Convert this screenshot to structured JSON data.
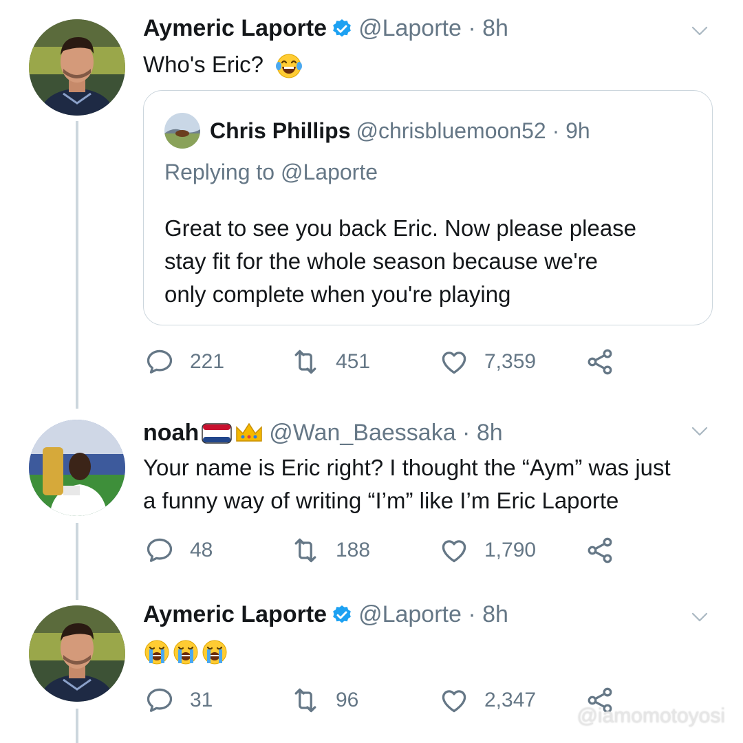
{
  "tweets": [
    {
      "name": "Aymeric Laporte",
      "handle": "@Laporte · 8h",
      "text_lines": [
        "Who's Eric?"
      ],
      "emoji": [
        "face-with-tears-of-joy"
      ],
      "quote": {
        "name": "Chris Phillips",
        "handle": "@chrisbluemoon52 · 9h",
        "replying_prefix": "Replying to ",
        "replying_mention": "@Laporte",
        "lines": [
          "Great to see you back Eric. Now please please",
          "stay fit for the whole season because we're",
          "only complete when you're playing"
        ]
      },
      "replies": "221",
      "retweets": "451",
      "likes": "7,359"
    },
    {
      "name": "noah",
      "handle": "@Wan_Baessaka · 8h",
      "name_icons": [
        "netherlands-flag",
        "crown"
      ],
      "text_lines": [
        "Your name is Eric right? I thought the “Aym” was just",
        "a funny way of writing “I’m” like I’m Eric Laporte"
      ],
      "replies": "48",
      "retweets": "188",
      "likes": "1,790"
    },
    {
      "name": "Aymeric Laporte",
      "handle": "@Laporte · 8h",
      "emoji": [
        "loudly-crying-face",
        "loudly-crying-face",
        "loudly-crying-face"
      ],
      "replies": "31",
      "retweets": "96",
      "likes": "2,347"
    }
  ],
  "watermark": "@iamomotoyosi",
  "colors": {
    "text": "#14171a",
    "secondary": "#657786",
    "verified": "#1da1f2",
    "border": "#ccd6dd"
  },
  "icons": [
    "reply-icon",
    "retweet-icon",
    "like-icon",
    "share-icon",
    "chevron-down-icon",
    "verified-badge-icon"
  ]
}
